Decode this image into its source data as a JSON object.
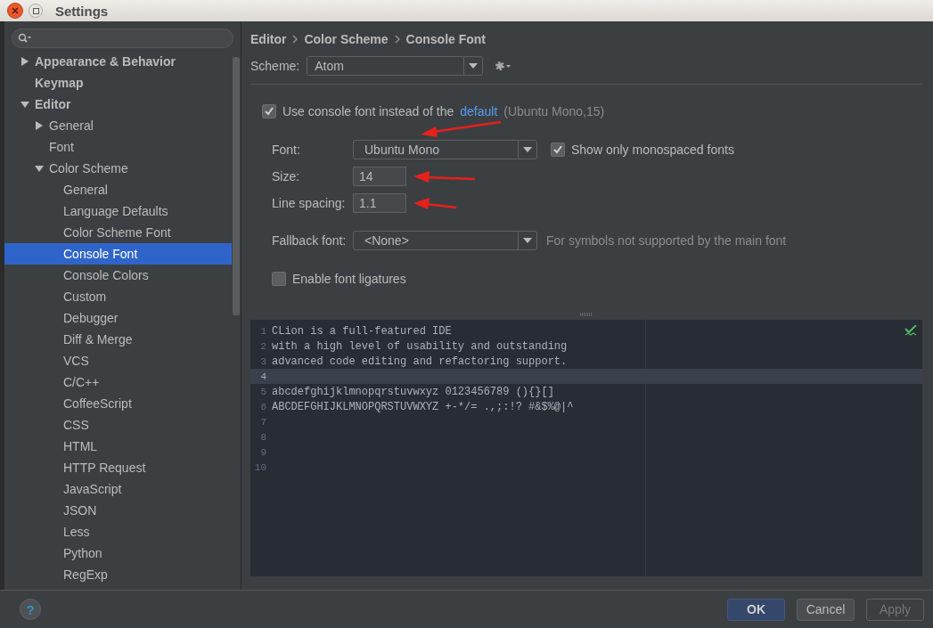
{
  "window": {
    "title": "Settings"
  },
  "sidebar": {
    "items": [
      {
        "label": "Appearance & Behavior",
        "expanded": false,
        "selected": false
      },
      {
        "label": "Keymap",
        "selected": false
      },
      {
        "label": "Editor",
        "expanded": true,
        "selected": false,
        "children": [
          {
            "label": "General",
            "expanded": false,
            "selected": false
          },
          {
            "label": "Font",
            "selected": false
          },
          {
            "label": "Color Scheme",
            "expanded": true,
            "selected": false,
            "children": [
              {
                "label": "General",
                "selected": false
              },
              {
                "label": "Language Defaults",
                "selected": false
              },
              {
                "label": "Color Scheme Font",
                "selected": false
              },
              {
                "label": "Console Font",
                "selected": true
              },
              {
                "label": "Console Colors",
                "selected": false
              },
              {
                "label": "Custom",
                "selected": false
              },
              {
                "label": "Debugger",
                "selected": false
              },
              {
                "label": "Diff & Merge",
                "selected": false
              },
              {
                "label": "VCS",
                "selected": false
              },
              {
                "label": "C/C++",
                "selected": false
              },
              {
                "label": "CoffeeScript",
                "selected": false
              },
              {
                "label": "CSS",
                "selected": false
              },
              {
                "label": "HTML",
                "selected": false
              },
              {
                "label": "HTTP Request",
                "selected": false
              },
              {
                "label": "JavaScript",
                "selected": false
              },
              {
                "label": "JSON",
                "selected": false
              },
              {
                "label": "Less",
                "selected": false
              },
              {
                "label": "Python",
                "selected": false
              },
              {
                "label": "RegExp",
                "selected": false
              }
            ]
          }
        ]
      }
    ]
  },
  "breadcrumb": [
    "Editor",
    "Color Scheme",
    "Console Font"
  ],
  "scheme": {
    "label": "Scheme:",
    "value": "Atom"
  },
  "use_console_font": {
    "checked": true,
    "text": "Use console font instead of the",
    "link": "default",
    "note": "(Ubuntu Mono,15)"
  },
  "font": {
    "label": "Font:",
    "value": "Ubuntu Mono"
  },
  "monospaced_only": {
    "checked": true,
    "label": "Show only monospaced fonts"
  },
  "size": {
    "label": "Size:",
    "value": "14"
  },
  "line_spacing": {
    "label": "Line spacing:",
    "value": "1.1"
  },
  "fallback_font": {
    "label": "Fallback font:",
    "value": "<None>",
    "hint": "For symbols not supported by the main font"
  },
  "ligatures": {
    "checked": false,
    "label": "Enable font ligatures"
  },
  "preview": {
    "lines": [
      {
        "number": "1",
        "text": "CLion is a full-featured IDE",
        "current": false
      },
      {
        "number": "2",
        "text": "with a high level of usability and outstanding",
        "current": false
      },
      {
        "number": "3",
        "text": "advanced code editing and refactoring support.",
        "current": false
      },
      {
        "number": "4",
        "current": true
      },
      {
        "number": "5",
        "text": "abcdefghijklmnopqrstuvwxyz 0123456789 (){}[]",
        "current": false
      },
      {
        "number": "6",
        "text": "ABCDEFGHIJKLMNOPQRSTUVWXYZ +-*/= .,;:!? #&$%@|^",
        "current": false
      },
      {
        "number": "7",
        "current": false
      },
      {
        "number": "8",
        "current": false
      },
      {
        "number": "9",
        "current": false
      },
      {
        "number": "10",
        "current": false
      }
    ]
  },
  "footer": {
    "help": "?",
    "buttons": [
      {
        "label": "OK",
        "kind": "default",
        "disabled": false
      },
      {
        "label": "Cancel",
        "kind": "normal",
        "disabled": false
      },
      {
        "label": "Apply",
        "kind": "normal",
        "disabled": true
      }
    ]
  }
}
